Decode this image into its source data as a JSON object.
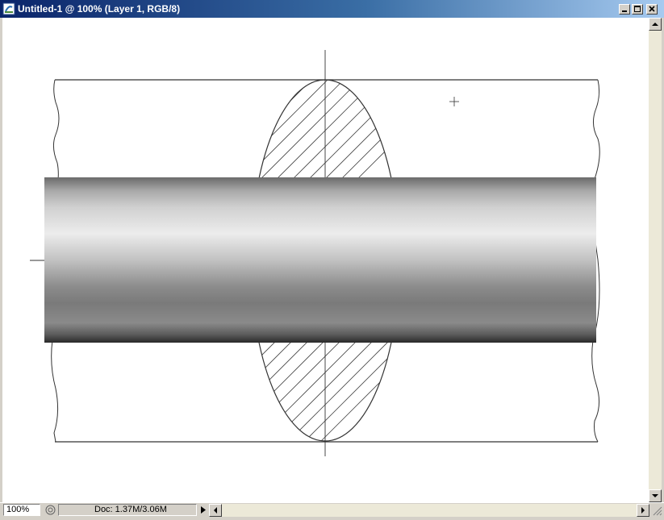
{
  "window": {
    "title": "Untitled-1 @ 100% (Layer 1, RGB/8)",
    "controls": [
      "minimize-icon",
      "maximize-icon",
      "close-icon"
    ]
  },
  "statusbar": {
    "zoom": "100%",
    "doc_info": "Doc: 1.37M/3.06M"
  },
  "colors": {
    "titlebar_start": "#0a246a",
    "titlebar_end": "#a6caf0",
    "chrome": "#d4d0c8",
    "canvas": "#ffffff",
    "line": "#333333"
  },
  "canvas": {
    "drawing": "technical sketch: pipe passing through wall with hatched elliptical section"
  }
}
